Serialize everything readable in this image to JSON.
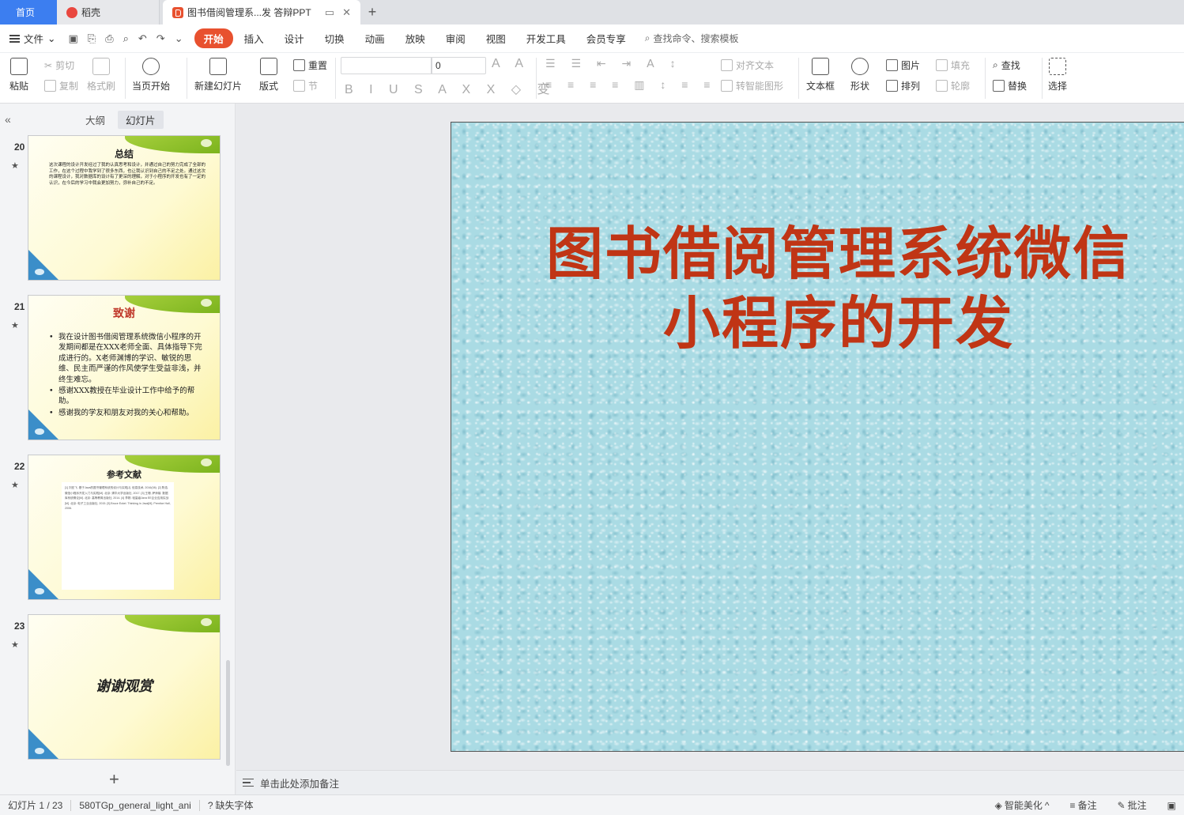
{
  "tabs": {
    "home": "首页",
    "daoke": "稻壳",
    "document": "图书借阅管理系...发 答辩PPT"
  },
  "menu": {
    "file": "文件",
    "items": [
      "开始",
      "插入",
      "设计",
      "切换",
      "动画",
      "放映",
      "审阅",
      "视图",
      "开发工具",
      "会员专享"
    ],
    "search": "查找命令、搜索模板"
  },
  "ribbon": {
    "paste": "粘贴",
    "cut": "剪切",
    "copy": "复制",
    "format_painter": "格式刷",
    "from_current": "当页开始",
    "new_slide": "新建幻灯片",
    "layout": "版式",
    "reset": "重置",
    "section": "节",
    "font_size": "0",
    "align_text": "对齐文本",
    "smart_art": "转智能图形",
    "textbox": "文本框",
    "shape": "形状",
    "picture": "图片",
    "arrange": "排列",
    "fill": "填充",
    "outline": "轮廓",
    "find": "查找",
    "replace": "替换",
    "select": "选择"
  },
  "left_panel": {
    "tab_outline": "大纲",
    "tab_slides": "幻灯片",
    "slides": [
      {
        "number": "20",
        "title": "总结",
        "body": "这次课程的设计开发经过了我的认真思考和设计，并通过自己的努力完成了全部的工作，在这个过程中我学到了很多东西，也让我认识到自己的不足之处。通过这次的课程设计，我对数据库的设计有了更深的理解，对于小程序的开发也有了一定的认识，在今后的学习中我会更加努力，弥补自己的不足。"
      },
      {
        "number": "21",
        "title": "致谢",
        "bullets": [
          "我在设计图书借阅管理系统微信小程序的开发期间都是在XXX老师全面、具体指导下完成进行的。X老师渊博的学识、敏锐的思维、民主而严谨的作风使学生受益非浅，并终生难忘。",
          "感谢XXX教授在毕业设计工作中给予的帮助。",
          "感谢我的学友和朋友对我的关心和帮助。"
        ]
      },
      {
        "number": "22",
        "title": "参考文献",
        "body": "[1] 刘亚飞. 基于Java的图书管理系统的设计与实现[J]. 信息技术, 2016(08). [2] 陈浩. 微信小程序开发入门与实践[M]. 北京: 清华大学出版社, 2017. [3] 王珊, 萨师煊. 数据库系统概论[M]. 北京: 高等教育出版社, 2014. [4] 李刚. 轻量级Java EE企业应用实战[M]. 北京: 电子工业出版社, 2015. [5] Bruce Eckel. Thinking in Java[M]. Prentice Hall, 2006."
      },
      {
        "number": "23",
        "title": "谢谢观赏"
      }
    ]
  },
  "slide": {
    "title_line1": "图书借阅管理系统微信",
    "title_line2": "小程序的开发"
  },
  "notes": {
    "placeholder": "单击此处添加备注"
  },
  "status": {
    "slide_counter": "幻灯片 1 / 23",
    "theme": "580TGp_general_light_ani",
    "missing_font": "缺失字体",
    "beautify": "智能美化",
    "notes": "备注",
    "comments": "批注"
  }
}
